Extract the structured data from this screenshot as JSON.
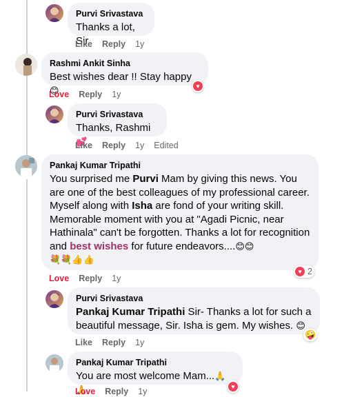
{
  "comments": [
    {
      "author": "Purvi Srivastava",
      "text": "Thanks a lot, Sir",
      "actions": {
        "like": "Like",
        "reply": "Reply",
        "time": "1y"
      }
    },
    {
      "author": "Rashmi Ankit Sinha",
      "text": "Best wishes dear !! Stay happy",
      "actions": {
        "like": "Love",
        "reply": "Reply",
        "time": "1y"
      }
    },
    {
      "author": "Purvi Srivastava",
      "text": "Thanks, Rashmi",
      "actions": {
        "like": "Like",
        "reply": "Reply",
        "time": "1y",
        "edited": "Edited"
      }
    },
    {
      "author": "Pankaj Kumar Tripathi",
      "text_parts": {
        "p1": "You surprised me ",
        "purvi": "Purvi",
        "p2": " Mam by giving this news. You are one of the best colleagues of my professional career. Myself along with ",
        "isha": "Isha",
        "p3": " are fond of your writing skill. Memorable moment with you at \"Agadi Picnic, near Hathinala\" can't be forgotten. Thanks a lot for recognition and ",
        "best_wishes": "best wishes",
        "p4": " for future endeavors...."
      },
      "actions": {
        "like": "Love",
        "reply": "Reply",
        "time": "1y"
      },
      "reaction_count": "2"
    },
    {
      "author": "Purvi Srivastava",
      "mention": "Pankaj Kumar Tripathi",
      "text": " Sir- Thanks a lot for such a beautiful message, Sir. Isha is gem. My wishes.",
      "actions": {
        "like": "Like",
        "reply": "Reply",
        "time": "1y"
      }
    },
    {
      "author": "Pankaj Kumar Tripathi",
      "text": "You are most welcome Mam...",
      "actions": {
        "like": "Love",
        "reply": "Reply",
        "time": "1y"
      }
    }
  ],
  "colors": {
    "bubble": "#f0f2f5",
    "love": "#e41e3f",
    "meta": "#65676b",
    "highlight": "#a0306b"
  }
}
